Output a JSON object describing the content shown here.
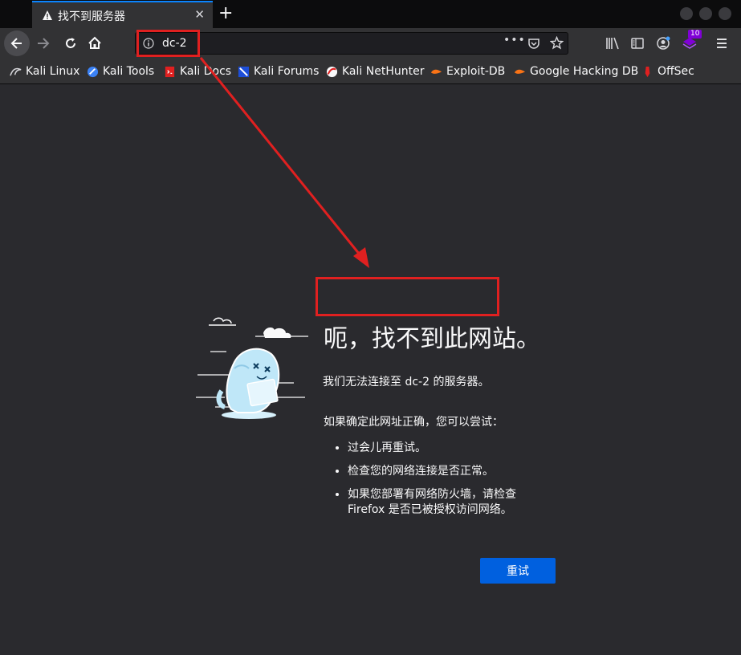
{
  "tab": {
    "title": "找不到服务器",
    "close": "✕",
    "new_tab": "+"
  },
  "url": {
    "value": "dc-2",
    "more": "•••"
  },
  "toolbar": {
    "badge_count": "10"
  },
  "bookmarks": [
    {
      "label": "Kali Linux",
      "icon": "kali-dragon-icon",
      "color": "#d7d7db"
    },
    {
      "label": "Kali Tools",
      "icon": "kali-tools-icon",
      "color": "#3b82f6"
    },
    {
      "label": "Kali Docs",
      "icon": "kali-docs-icon",
      "color": "#e02020"
    },
    {
      "label": "Kali Forums",
      "icon": "kali-forums-icon",
      "color": "#1d4ed8"
    },
    {
      "label": "Kali NetHunter",
      "icon": "nethunter-icon",
      "color": "#e02020"
    },
    {
      "label": "Exploit-DB",
      "icon": "exploit-db-icon",
      "color": "#f97316"
    },
    {
      "label": "Google Hacking DB",
      "icon": "ghdb-icon",
      "color": "#f97316"
    },
    {
      "label": "OffSec",
      "icon": "offsec-icon",
      "color": "#e02020"
    }
  ],
  "error": {
    "title": "呃，找不到此网站。",
    "subtitle": "我们无法连接至 dc-2 的服务器。",
    "prompt": "如果确定此网址正确，您可以尝试：",
    "items": [
      "过会儿再重试。",
      "检查您的网络连接是否正常。",
      "如果您部署有网络防火墙，请检查 Firefox 是否已被授权访问网络。"
    ],
    "retry_label": "重试"
  },
  "colors": {
    "accent": "#0a84ff",
    "button": "#0060df",
    "highlight": "#e02020",
    "background": "#2a2a2e"
  }
}
